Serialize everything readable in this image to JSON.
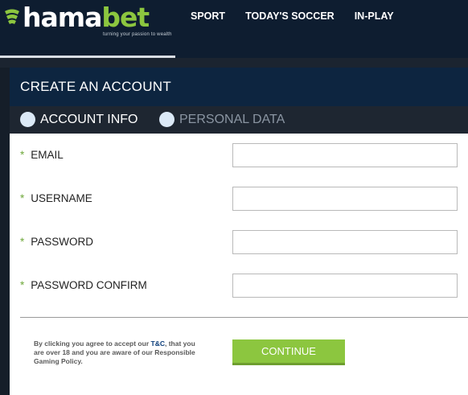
{
  "brand": {
    "name_main": "hama",
    "name_accent": "bet",
    "tagline": "turning your passion to wealth",
    "accent_color": "#8cc63f"
  },
  "nav": {
    "items": [
      {
        "label": "SPORT"
      },
      {
        "label": "TODAY'S SOCCER"
      },
      {
        "label": "IN-PLAY"
      }
    ]
  },
  "form": {
    "title": "CREATE AN ACCOUNT",
    "steps": [
      {
        "label": "ACCOUNT INFO",
        "active": true
      },
      {
        "label": "PERSONAL DATA",
        "active": false
      }
    ],
    "required_marker": "*",
    "fields": [
      {
        "label": "EMAIL",
        "value": ""
      },
      {
        "label": "USERNAME",
        "value": ""
      },
      {
        "label": "PASSWORD",
        "value": ""
      },
      {
        "label": "PASSWORD CONFIRM",
        "value": ""
      }
    ],
    "terms": {
      "text_before": "By clicking you agree to accept our ",
      "link": "T&C",
      "text_after": ", that you are over 18 and you are aware of our Responsible Gaming Policy."
    },
    "continue_label": "CONTINUE"
  }
}
